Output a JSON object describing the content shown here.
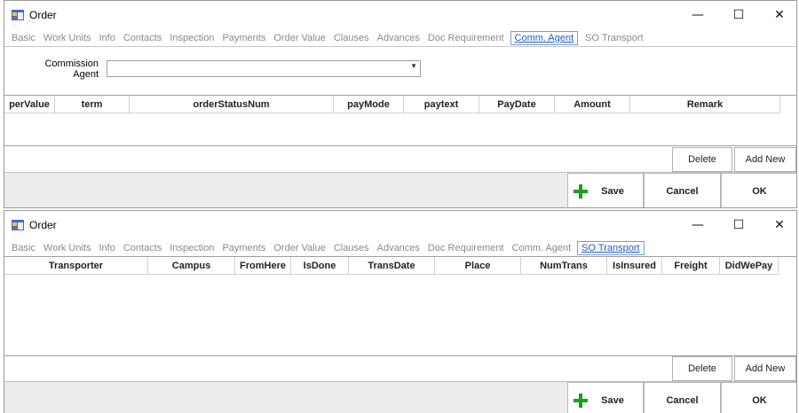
{
  "windows": [
    {
      "title": "Order",
      "tabs": [
        "Basic",
        "Work Units",
        "Info",
        "Contacts",
        "Inspection",
        "Payments",
        "Order Value",
        "Clauses",
        "Advances",
        "Doc Requirement",
        "Comm. Agent",
        "SO Transport"
      ],
      "active_tab": "Comm. Agent",
      "commission_label_1": "Commission",
      "commission_label_2": "Agent",
      "columns": [
        "perValue",
        "term",
        "orderStatusNum",
        "payMode",
        "paytext",
        "PayDate",
        "Amount",
        "Remark"
      ],
      "delete_label": "Delete",
      "add_label": "Add New",
      "save_label": "Save",
      "cancel_label": "Cancel",
      "ok_label": "OK"
    },
    {
      "title": "Order",
      "tabs": [
        "Basic",
        "Work Units",
        "Info",
        "Contacts",
        "Inspection",
        "Payments",
        "Order Value",
        "Clauses",
        "Advances",
        "Doc Requirement",
        "Comm. Agent",
        "SO Transport"
      ],
      "active_tab": "SO Transport",
      "columns": [
        "Transporter",
        "Campus",
        "FromHere",
        "IsDone",
        "TransDate",
        "Place",
        "NumTrans",
        "IsInsured",
        "Freight",
        "DidWePay"
      ],
      "delete_label": "Delete",
      "add_label": "Add New",
      "save_label": "Save",
      "cancel_label": "Cancel",
      "ok_label": "OK"
    }
  ],
  "colors": {
    "active_tab": "#1f5fbf",
    "save_plus": "#1e9e1e",
    "bottom_bar": "#ececec"
  },
  "icons": {
    "app": "app-window-icon",
    "min": "minimize-icon",
    "max": "maximize-icon",
    "close": "close-icon",
    "save": "plus-icon",
    "dropdown": "chevron-down-icon"
  }
}
